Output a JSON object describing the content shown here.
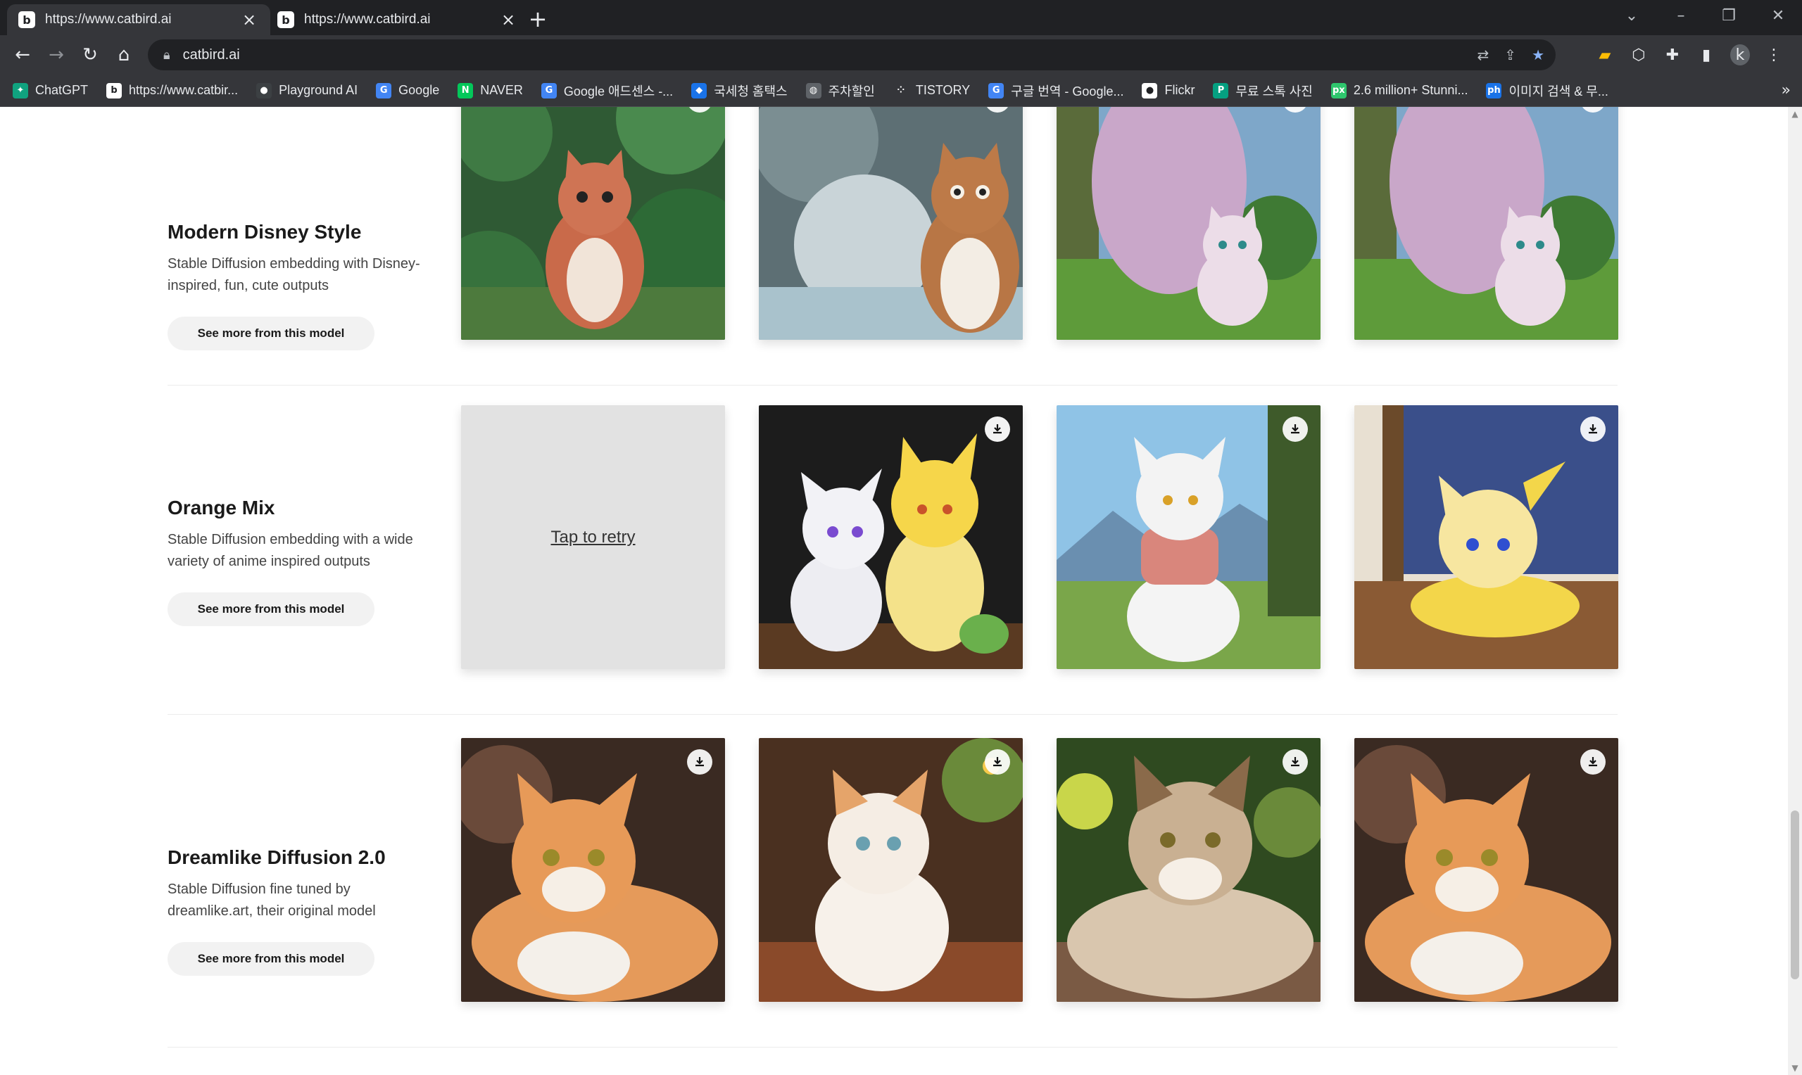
{
  "browser": {
    "tabs": [
      {
        "title": "https://www.catbird.ai",
        "favicon": "catbird-favicon",
        "active": true
      },
      {
        "title": "https://www.catbird.ai",
        "favicon": "catbird-favicon",
        "active": false
      }
    ],
    "address": "catbird.ai",
    "profile_initial": "k",
    "bookmarks": [
      {
        "label": "ChatGPT",
        "icon": "chatgpt-icon",
        "color": "#10a37f",
        "glyph": "✦"
      },
      {
        "label": "https://www.catbir...",
        "icon": "catbird-favicon",
        "color": "#ffffff",
        "glyph": "b"
      },
      {
        "label": "Playground AI",
        "icon": "playground-icon",
        "color": "#3c4043",
        "glyph": "●"
      },
      {
        "label": "Google",
        "icon": "google-icon",
        "color": "#4285f4",
        "glyph": "G"
      },
      {
        "label": "NAVER",
        "icon": "naver-icon",
        "color": "#03c75a",
        "glyph": "N"
      },
      {
        "label": "Google 애드센스 -...",
        "icon": "google-icon",
        "color": "#4285f4",
        "glyph": "G"
      },
      {
        "label": "국세청 홈택스",
        "icon": "hometax-icon",
        "color": "#1a73e8",
        "glyph": "◆"
      },
      {
        "label": "주차할인",
        "icon": "globe-icon",
        "color": "#5f6368",
        "glyph": "◍"
      },
      {
        "label": "TISTORY",
        "icon": "tistory-icon",
        "color": "#35363a",
        "glyph": "⁘"
      },
      {
        "label": "구글 번역 - Google...",
        "icon": "google-icon",
        "color": "#4285f4",
        "glyph": "G"
      },
      {
        "label": "Flickr",
        "icon": "flickr-icon",
        "color": "#ffffff",
        "glyph": "●"
      },
      {
        "label": "무료 스톡 사진",
        "icon": "pexels-icon",
        "color": "#05a081",
        "glyph": "P"
      },
      {
        "label": "2.6 million+ Stunni...",
        "icon": "pixabay-icon",
        "color": "#2ec66d",
        "glyph": "px"
      },
      {
        "label": "이미지 검색 & 무...",
        "icon": "photohome-icon",
        "color": "#1a73e8",
        "glyph": "ph"
      }
    ]
  },
  "models": [
    {
      "title": "Modern Disney Style",
      "description": "Stable Diffusion embedding with Disney-inspired, fun, cute outputs",
      "button": "See more from this model"
    },
    {
      "title": "Orange Mix",
      "description": "Stable Diffusion embedding with a wide variety of anime inspired outputs",
      "button": "See more from this model",
      "retry_label": "Tap to retry"
    },
    {
      "title": "Dreamlike Diffusion 2.0",
      "description": "Stable Diffusion fine tuned by dreamlike.art, their original model",
      "button": "See more from this model"
    }
  ],
  "colors": {
    "accent": "#8ab4f8",
    "chrome_dark": "#202124",
    "chrome_mid": "#35363a"
  }
}
